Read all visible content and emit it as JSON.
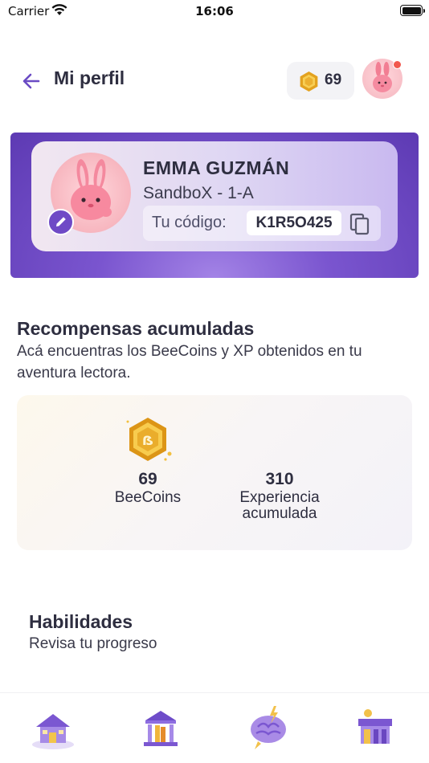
{
  "status_bar": {
    "carrier": "Carrier",
    "time": "16:06"
  },
  "header": {
    "title": "Mi perfil",
    "coin_count": "69",
    "icons": {
      "back": "arrow-left-icon",
      "coin": "beecoin-icon",
      "avatar": "bunny-avatar"
    }
  },
  "profile": {
    "name": "EMMA GUZMÁN",
    "class": "SandboX - 1-A",
    "code_label": "Tu código:",
    "code_value": "K1R5O425"
  },
  "rewards": {
    "title": "Recompensas acumuladas",
    "subtitle_line1": "Acá encuentras los BeeCoins y XP obtenidos en tu",
    "subtitle_line2": "aventura lectora.",
    "beecoins_value": "69",
    "beecoins_label": "BeeCoins",
    "xp_value": "310",
    "xp_label_line1": "Experiencia",
    "xp_label_line2": "acumulada"
  },
  "skills": {
    "title": "Habilidades",
    "subtitle": "Revisa tu progreso"
  },
  "bottom_nav": {
    "items": [
      {
        "icon": "home-icon"
      },
      {
        "icon": "library-icon"
      },
      {
        "icon": "brain-icon"
      },
      {
        "icon": "store-icon"
      }
    ]
  },
  "colors": {
    "accent": "#6f4ac6",
    "card_gradient": "#7a55cf",
    "notification": "#f2584e",
    "coin": "#e9a923"
  }
}
